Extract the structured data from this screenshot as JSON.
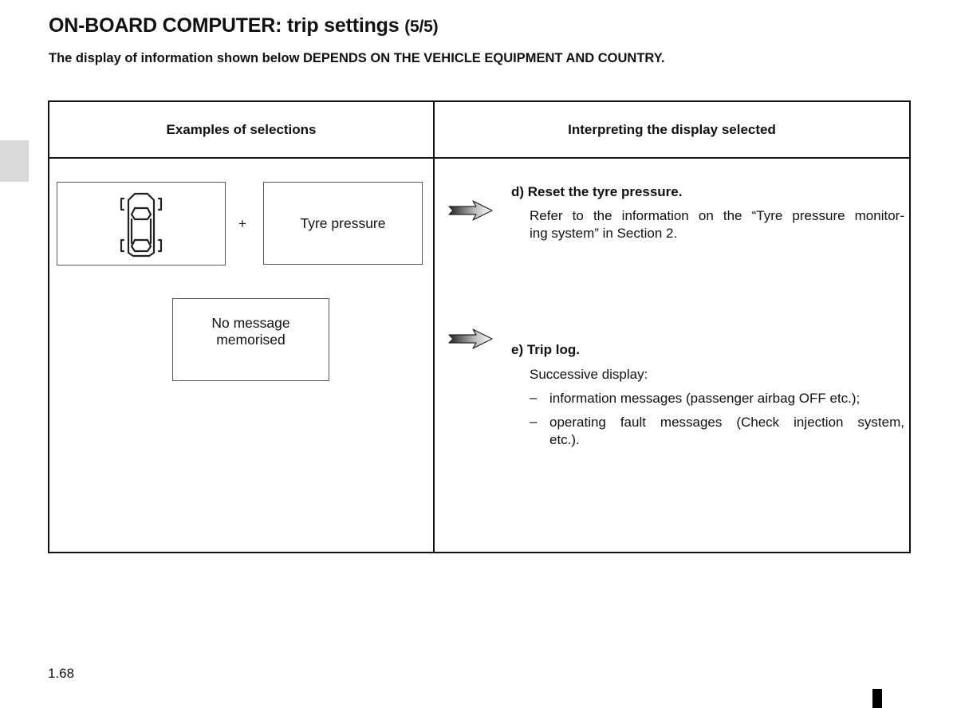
{
  "header": {
    "title": "ON-BOARD COMPUTER: trip settings",
    "page_indicator": "(5/5)",
    "subtitle": "The display of information shown below DEPENDS ON THE VEHICLE EQUIPMENT AND COUNTRY."
  },
  "table": {
    "columns": [
      "Examples of selections",
      "Interpreting the display selected"
    ],
    "left": {
      "display_icon": "car-tyres-top-view-icon",
      "plus_label": "+",
      "tyre_pressure_label": "Tyre pressure",
      "no_message_line1": "No message",
      "no_message_line2": "memorised"
    },
    "right": {
      "items": [
        {
          "icon": "arrow-right-icon",
          "label": "d)",
          "heading": "Reset the tyre pressure.",
          "text_line1": "Refer to the information on the “Tyre pressure monitor-",
          "text_line2": "ing system” in Section 2."
        },
        {
          "icon": "arrow-right-icon",
          "label": "e)",
          "heading": "Trip log.",
          "intro": "Successive display:",
          "bullets": [
            {
              "dash": "–",
              "line1": "information messages (passenger airbag OFF etc.);"
            },
            {
              "dash": "–",
              "line1": "operating fault messages (Check injection system,",
              "line2": "etc.)."
            }
          ]
        }
      ]
    }
  },
  "footer": {
    "page_number": "1.68"
  }
}
